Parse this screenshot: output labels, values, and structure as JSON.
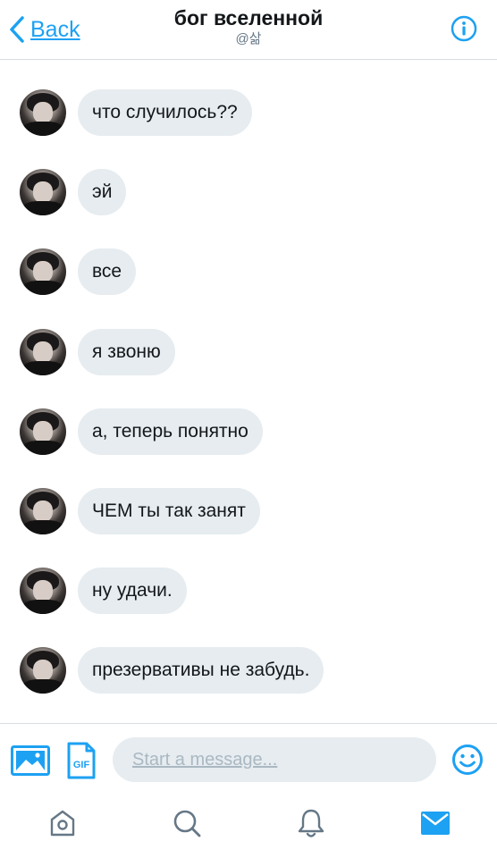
{
  "header": {
    "back_label": "Back",
    "title": "бог вселенной",
    "handle": "@삶"
  },
  "messages": [
    {
      "text": "что случилось??"
    },
    {
      "text": "эй"
    },
    {
      "text": "все"
    },
    {
      "text": "я звоню"
    },
    {
      "text": "а, теперь понятно"
    },
    {
      "text": "ЧЕМ ты так занят"
    },
    {
      "text": "ну удачи."
    },
    {
      "text": "презервативы не забудь."
    }
  ],
  "composer": {
    "placeholder": "Start a message...",
    "gif_label": "GIF"
  },
  "tabs": [
    {
      "icon": "home-icon",
      "active": false
    },
    {
      "icon": "search-icon",
      "active": false
    },
    {
      "icon": "bell-icon",
      "active": false
    },
    {
      "icon": "mail-icon",
      "active": true
    }
  ],
  "colors": {
    "accent": "#1da1f2",
    "bubble": "#e6ecf0",
    "text": "#14171a",
    "muted": "#657786",
    "icon_gray": "#657786"
  }
}
